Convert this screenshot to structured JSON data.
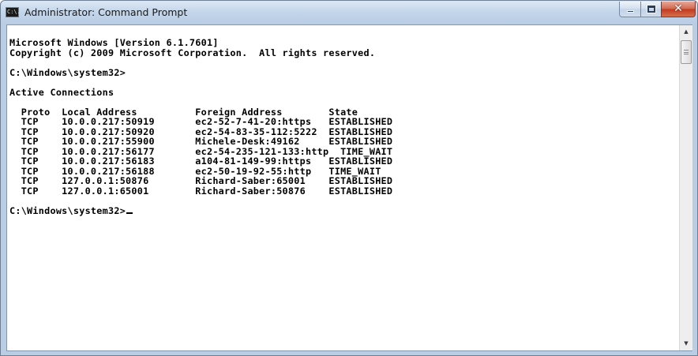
{
  "window": {
    "title": "Administrator: Command Prompt",
    "icon_name": "cmd-icon",
    "icon_text": "C:\\."
  },
  "console": {
    "lines": [
      "Microsoft Windows [Version 6.1.7601]",
      "Copyright (c) 2009 Microsoft Corporation.  All rights reserved.",
      "",
      "C:\\Windows\\system32>",
      "",
      "Active Connections",
      "",
      "  Proto  Local Address          Foreign Address        State",
      "  TCP    10.0.0.217:50919       ec2-52-7-41-20:https   ESTABLISHED",
      "  TCP    10.0.0.217:50920       ec2-54-83-35-112:5222  ESTABLISHED",
      "  TCP    10.0.0.217:55900       Michele-Desk:49162     ESTABLISHED",
      "  TCP    10.0.0.217:56177       ec2-54-235-121-133:http  TIME_WAIT",
      "  TCP    10.0.0.217:56183       a104-81-149-99:https   ESTABLISHED",
      "  TCP    10.0.0.217:56188       ec2-50-19-92-55:http   TIME_WAIT",
      "  TCP    127.0.0.1:50876        Richard-Saber:65001    ESTABLISHED",
      "  TCP    127.0.0.1:65001        Richard-Saber:50876    ESTABLISHED",
      "",
      "C:\\Windows\\system32>"
    ]
  },
  "colors": {
    "console_background": "#ffffff",
    "console_text": "#000000",
    "close_button": "#c2391d"
  }
}
